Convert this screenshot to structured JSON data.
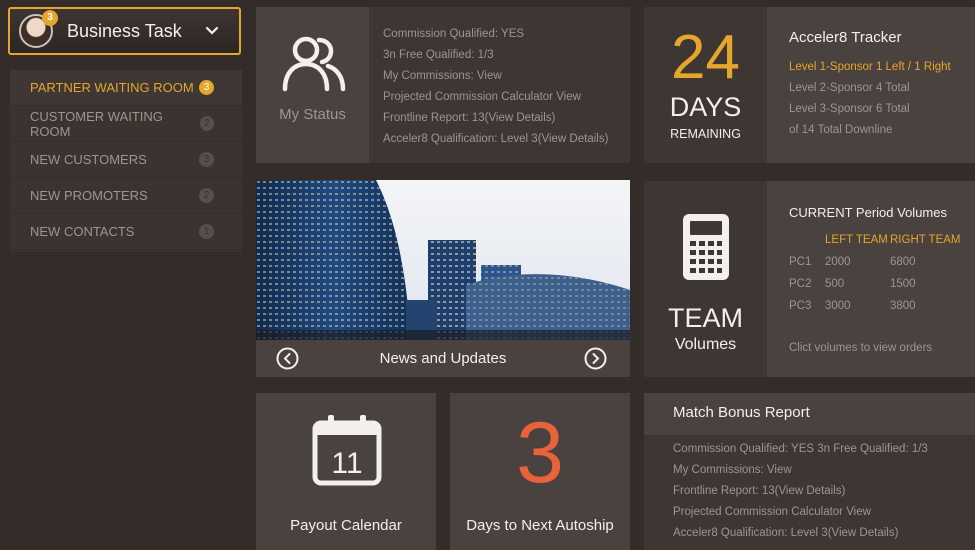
{
  "task": {
    "title": "Business Task",
    "badge": "3"
  },
  "menu": [
    {
      "label": "PARTNER WAITING ROOM",
      "count": "3",
      "active": true
    },
    {
      "label": "CUSTOMER WAITING ROOM",
      "count": "2",
      "active": false
    },
    {
      "label": "NEW CUSTOMERS",
      "count": "3",
      "active": false
    },
    {
      "label": "NEW PROMOTERS",
      "count": "2",
      "active": false
    },
    {
      "label": "NEW CONTACTS",
      "count": "1",
      "active": false
    }
  ],
  "status": {
    "label": "My Status",
    "lines": [
      "Commission Qualified:   YES",
      "3n Free Qualified:   1/3",
      "My Commissions:  View",
      "Projected Commission Calculator  View",
      "Frontline Report: 13(View Details)",
      "Acceler8 Qualification: Level 3(View Details)"
    ]
  },
  "accel": {
    "days": "24",
    "days_word": "DAYS",
    "remaining": "REMAINING",
    "title": "Acceler8 Tracker",
    "highlight": "Level 1-Sponsor 1 Left / 1 Right",
    "lines": [
      "Level 2-Sponsor 4 Total",
      "Level 3-Sponsor 6 Total",
      "of 14 Total Downline"
    ]
  },
  "news": {
    "title": "News and Updates"
  },
  "team": {
    "word": "TEAM",
    "sub": "Volumes",
    "title": "CURRENT Period Volumes",
    "left_header": "LEFT TEAM",
    "right_header": "RIGHT TEAM",
    "rows": [
      {
        "pc": "PC1",
        "left": "2000",
        "right": "6800"
      },
      {
        "pc": "PC2",
        "left": "500",
        "right": "1500"
      },
      {
        "pc": "PC3",
        "left": "3000",
        "right": "3800"
      }
    ],
    "footer": "Clict volumes to view orders"
  },
  "payout": {
    "label": "Payout Calendar",
    "day": "11"
  },
  "autoship": {
    "number": "3",
    "label": "Days to Next Autoship"
  },
  "match": {
    "title": "Match Bonus Report",
    "lines": [
      "Commission Qualified:   YES    3n Free Qualified:   1/3",
      "My Commissions:  View",
      "Frontline Report: 13(View Details)",
      "Projected Commission Calculator  View",
      "Acceler8 Qualification: Level 3(View Details)"
    ]
  },
  "colors": {
    "accent": "#e6a52c",
    "autoship": "#e8623c",
    "background": "#332c29"
  }
}
